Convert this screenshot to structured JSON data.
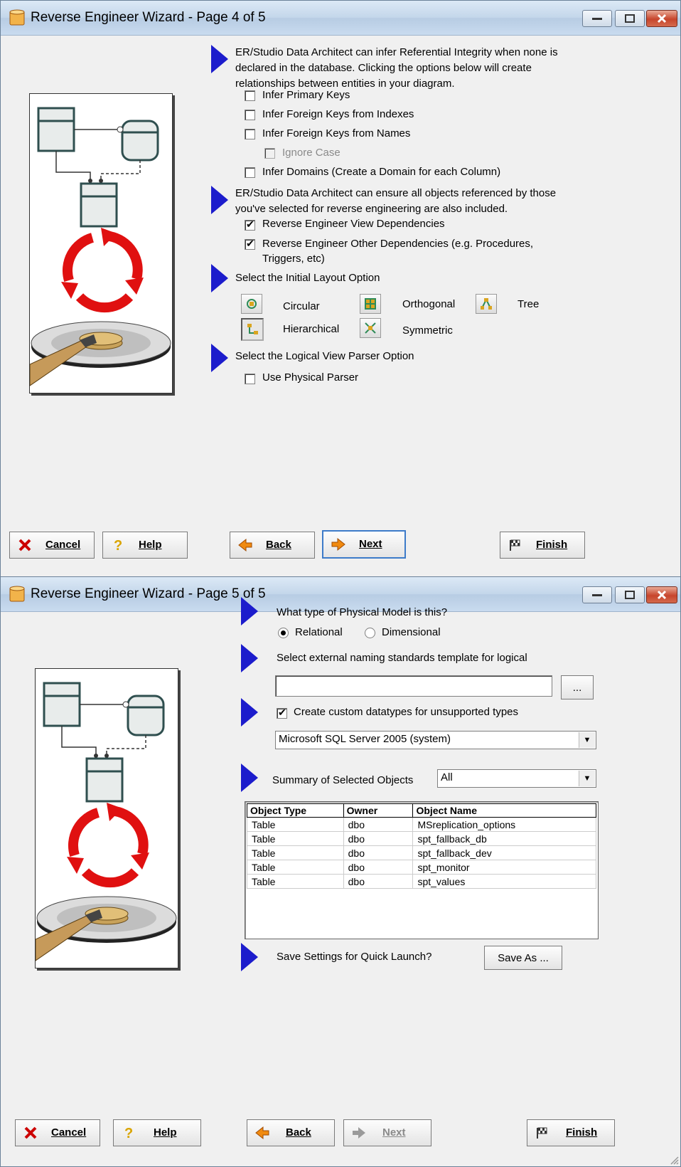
{
  "page4": {
    "title": "Reverse Engineer Wizard - Page 4 of 5",
    "ri_intro": "ER/Studio Data Architect can infer Referential Integrity when none is declared in the database. Clicking the options below will create relationships between entities in your diagram.",
    "infer_primary_keys": "Infer Primary Keys",
    "infer_fk_indexes": "Infer Foreign Keys from Indexes",
    "infer_fk_names": "Infer Foreign Keys from Names",
    "ignore_case": "Ignore Case",
    "infer_domains": "Infer Domains (Create a Domain for each Column)",
    "dep_intro": "ER/Studio Data Architect can ensure all objects referenced by those you've selected for reverse engineering are also included.",
    "re_view_deps": "Reverse Engineer View Dependencies",
    "re_other_deps": "Reverse Engineer Other Dependencies (e.g. Procedures, Triggers, etc)",
    "layout_heading": "Select the Initial Layout Option",
    "layout_circular": "Circular",
    "layout_orthogonal": "Orthogonal",
    "layout_tree": "Tree",
    "layout_hierarchical": "Hierarchical",
    "layout_symmetric": "Symmetric",
    "parser_heading": "Select the Logical View Parser Option",
    "use_physical_parser": "Use Physical Parser"
  },
  "page5": {
    "title": "Reverse Engineer Wizard - Page 5 of 5",
    "model_question": "What type of Physical Model is this?",
    "relational": "Relational",
    "dimensional": "Dimensional",
    "naming_heading": "Select external naming standards template for logical",
    "naming_value": "",
    "browse_label": "...",
    "custom_datatypes": "Create custom datatypes for unsupported types",
    "datatype_select": "Microsoft SQL Server 2005 (system)",
    "summary_label": "Summary of Selected Objects",
    "summary_select": "All",
    "columns": [
      "Object Type",
      "Owner",
      "Object Name"
    ],
    "rows": [
      [
        "Table",
        "dbo",
        "MSreplication_options"
      ],
      [
        "Table",
        "dbo",
        "spt_fallback_db"
      ],
      [
        "Table",
        "dbo",
        "spt_fallback_dev"
      ],
      [
        "Table",
        "dbo",
        "spt_monitor"
      ],
      [
        "Table",
        "dbo",
        "spt_values"
      ]
    ],
    "save_settings": "Save Settings for Quick Launch?",
    "save_as": "Save As ..."
  },
  "buttons": {
    "cancel": "Cancel",
    "help": "Help",
    "back": "Back",
    "next": "Next",
    "finish": "Finish"
  },
  "colors": {
    "arrow_blue": "#1c1ccc",
    "recycle_red": "#e01010",
    "close_red": "#c7452c"
  }
}
